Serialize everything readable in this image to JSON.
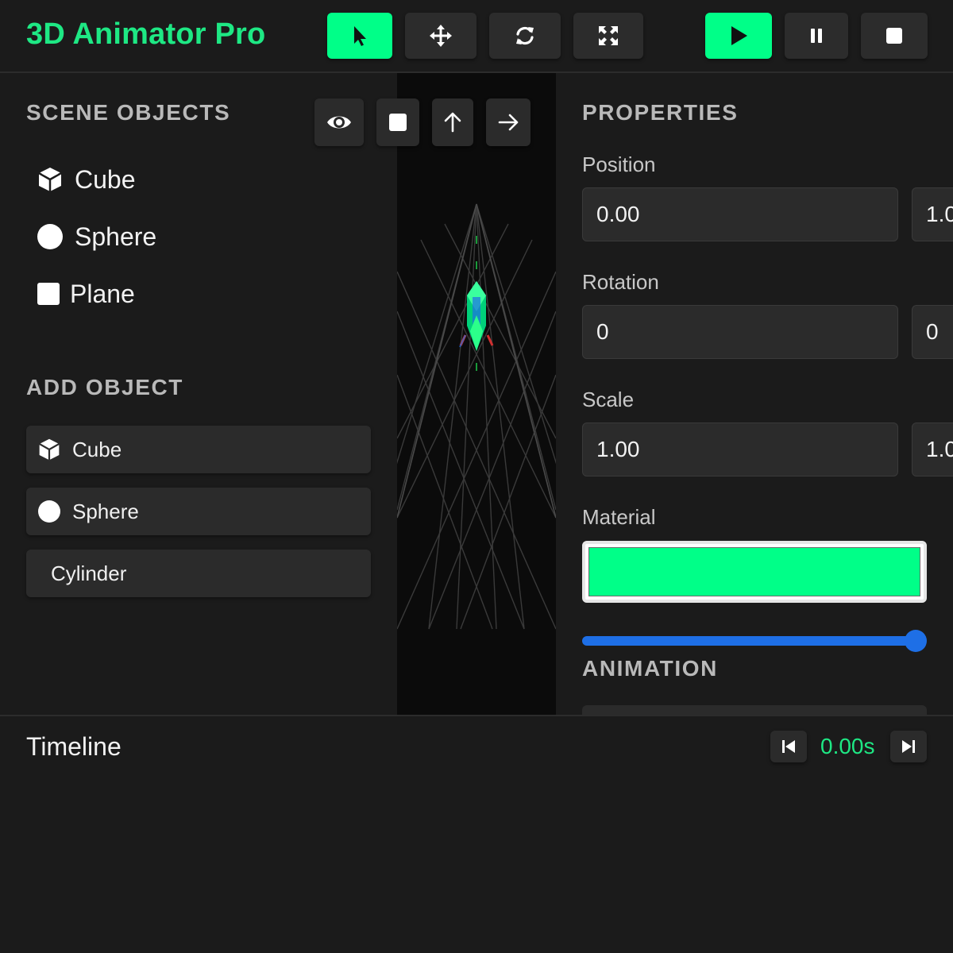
{
  "app": {
    "title": "3D Animator Pro"
  },
  "toolbar": {
    "tools": [
      {
        "icon": "select-arrow-icon",
        "active": true
      },
      {
        "icon": "move-icon",
        "active": false
      },
      {
        "icon": "rotate-icon",
        "active": false
      },
      {
        "icon": "scale-icon",
        "active": false
      }
    ],
    "playback": [
      {
        "icon": "play-icon",
        "active": true
      },
      {
        "icon": "pause-icon",
        "active": false
      },
      {
        "icon": "stop-icon",
        "active": false
      }
    ]
  },
  "scene": {
    "title": "SCENE OBJECTS",
    "objects": [
      {
        "label": "Cube",
        "icon": "cube-icon"
      },
      {
        "label": "Sphere",
        "icon": "sphere-icon"
      },
      {
        "label": "Plane",
        "icon": "plane-icon"
      }
    ]
  },
  "add_object": {
    "title": "ADD OBJECT",
    "buttons": [
      {
        "label": "Cube",
        "icon": "cube-icon"
      },
      {
        "label": "Sphere",
        "icon": "sphere-icon"
      },
      {
        "label": "Cylinder",
        "icon": ""
      }
    ]
  },
  "viewport": {
    "buttons": [
      "eye-icon",
      "square-icon",
      "arrow-up-icon",
      "arrow-right-icon"
    ]
  },
  "properties": {
    "title": "PROPERTIES",
    "position": {
      "label": "Position",
      "x": "0.00",
      "y": "1.0"
    },
    "rotation": {
      "label": "Rotation",
      "x": "0",
      "y": "0"
    },
    "scale": {
      "label": "Scale",
      "x": "1.00",
      "y": "1.0"
    },
    "material": {
      "label": "Material",
      "color": "#00ff88"
    },
    "slider_value": 1.0
  },
  "animation": {
    "title": "ANIMATION"
  },
  "timeline": {
    "title": "Timeline",
    "time": "0.00s"
  },
  "colors": {
    "accent": "#00ff88",
    "slider": "#1e6fe6",
    "background": "#1b1b1b"
  }
}
